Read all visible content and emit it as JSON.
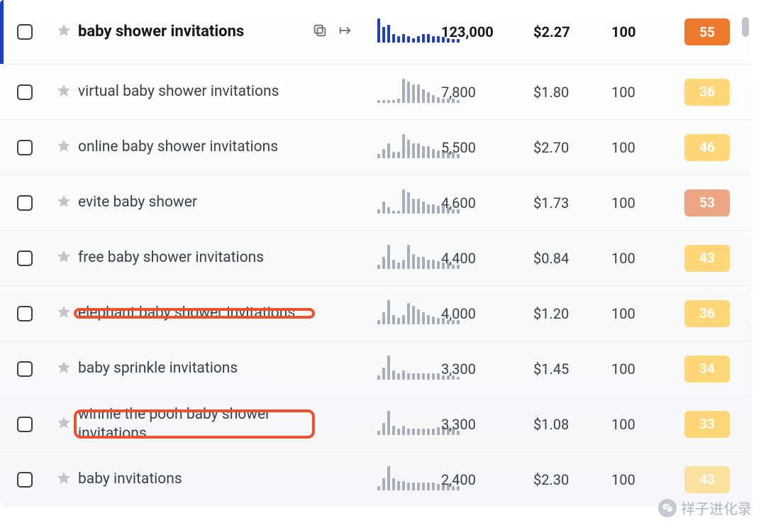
{
  "badge_colors": {
    "orange_strong": "#ed7a2c",
    "salmon": "#eda583",
    "yellow": "#ffd776"
  },
  "rows": [
    {
      "keyword": "baby shower invitations",
      "volume": "123,000",
      "cpc": "$2.27",
      "pd": "100",
      "kd": "55",
      "kd_color": "orange_strong",
      "primary": true,
      "trend": [
        22,
        14,
        16,
        8,
        6,
        8,
        6,
        4,
        6,
        8,
        8,
        6,
        6,
        5,
        4,
        3,
        3
      ],
      "highlight": false
    },
    {
      "keyword": "virtual baby shower invitations",
      "volume": "7,800",
      "cpc": "$1.80",
      "pd": "100",
      "kd": "36",
      "kd_color": "yellow",
      "primary": false,
      "trend": [
        2,
        2,
        2,
        2,
        3,
        18,
        16,
        14,
        14,
        10,
        8,
        6,
        4,
        3,
        3,
        3,
        2
      ],
      "highlight": false
    },
    {
      "keyword": "online baby shower invitations",
      "volume": "5,500",
      "cpc": "$2.70",
      "pd": "100",
      "kd": "46",
      "kd_color": "yellow",
      "primary": false,
      "trend": [
        3,
        6,
        10,
        4,
        4,
        16,
        12,
        10,
        10,
        8,
        8,
        6,
        5,
        5,
        4,
        4,
        3
      ],
      "highlight": false
    },
    {
      "keyword": "evite baby shower",
      "volume": "4,600",
      "cpc": "$1.73",
      "pd": "100",
      "kd": "53",
      "kd_color": "salmon",
      "primary": false,
      "trend": [
        3,
        8,
        4,
        2,
        2,
        16,
        14,
        10,
        10,
        8,
        6,
        6,
        5,
        5,
        4,
        3,
        3
      ],
      "highlight": false
    },
    {
      "keyword": "free baby shower invitations",
      "volume": "4,400",
      "cpc": "$0.84",
      "pd": "100",
      "kd": "43",
      "kd_color": "yellow",
      "primary": false,
      "trend": [
        3,
        8,
        16,
        6,
        4,
        6,
        16,
        10,
        8,
        8,
        6,
        6,
        5,
        4,
        4,
        3,
        3
      ],
      "highlight": false
    },
    {
      "keyword": "elephant baby shower invitations",
      "volume": "4,000",
      "cpc": "$1.20",
      "pd": "100",
      "kd": "36",
      "kd_color": "yellow",
      "primary": false,
      "trend": [
        3,
        8,
        16,
        6,
        4,
        6,
        14,
        12,
        10,
        8,
        6,
        5,
        4,
        4,
        3,
        3,
        3
      ],
      "highlight": true
    },
    {
      "keyword": "baby sprinkle invitations",
      "volume": "3,300",
      "cpc": "$1.45",
      "pd": "100",
      "kd": "34",
      "kd_color": "yellow",
      "primary": false,
      "trend": [
        3,
        8,
        16,
        6,
        4,
        6,
        4,
        4,
        4,
        4,
        4,
        4,
        4,
        3,
        3,
        3,
        2
      ],
      "highlight": false
    },
    {
      "keyword": "winnie the pooh baby shower invitations",
      "volume": "3,300",
      "cpc": "$1.08",
      "pd": "100",
      "kd": "33",
      "kd_color": "yellow",
      "primary": false,
      "trend": [
        3,
        8,
        16,
        6,
        4,
        6,
        4,
        4,
        4,
        4,
        4,
        4,
        5,
        6,
        5,
        4,
        3
      ],
      "highlight": true
    },
    {
      "keyword": "baby invitations",
      "volume": "2,400",
      "cpc": "$2.30",
      "pd": "100",
      "kd": "43",
      "kd_color": "yellow",
      "primary": false,
      "trend": [
        3,
        8,
        16,
        8,
        6,
        6,
        5,
        5,
        5,
        5,
        5,
        5,
        4,
        4,
        4,
        3,
        3
      ],
      "highlight": false,
      "last": true
    }
  ],
  "watermark": "祥子进化录"
}
